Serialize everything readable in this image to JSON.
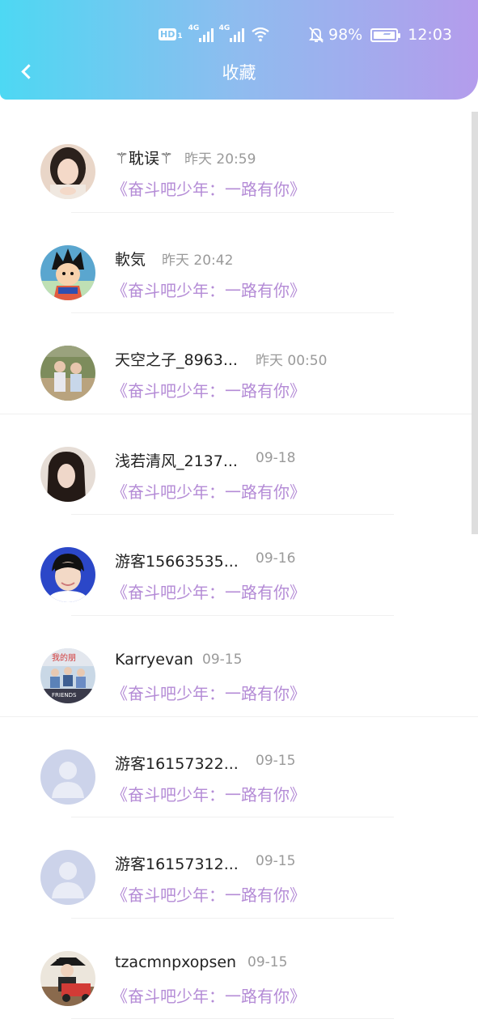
{
  "status_bar": {
    "hd_label": "HD",
    "hd_sub": "1",
    "sig1_label": "4G",
    "sig2_label": "4G",
    "battery_pct": "98%",
    "time": "12:03",
    "battery_level": 0.98
  },
  "header": {
    "title": "收藏",
    "gradient": [
      "#4dd8f3",
      "#b49cec"
    ]
  },
  "items": [
    {
      "name": "⚚耽误⚚",
      "time": "昨天 20:59",
      "subtitle": "《奋斗吧少年：一路有你》",
      "avatar": "photo-girl"
    },
    {
      "name": "軟気",
      "time": "昨天 20:42",
      "subtitle": "《奋斗吧少年：一路有你》",
      "avatar": "cartoon-boy"
    },
    {
      "name": "天空之子_8963...",
      "time": "昨天 00:50",
      "subtitle": "《奋斗吧少年：一路有你》",
      "avatar": "photo-kids"
    },
    {
      "name": "浅若清风_2137...",
      "time": "09-18",
      "subtitle": "《奋斗吧少年：一路有你》",
      "avatar": "photo-woman"
    },
    {
      "name": "游客15663535...",
      "time": "09-16",
      "subtitle": "《奋斗吧少年：一路有你》",
      "avatar": "photo-boy"
    },
    {
      "name": "Karryevan",
      "time": "09-15",
      "subtitle": "《奋斗吧少年：一路有你》",
      "avatar": "photo-group"
    },
    {
      "name": "游客16157322...",
      "time": "09-15",
      "subtitle": "《奋斗吧少年：一路有你》",
      "avatar": "default-avatar"
    },
    {
      "name": "游客16157312...",
      "time": "09-15",
      "subtitle": "《奋斗吧少年：一路有你》",
      "avatar": "default-avatar"
    },
    {
      "name": "tzacmnpxopsen",
      "time": "09-15",
      "subtitle": "《奋斗吧少年：一路有你》",
      "avatar": "photo-cowboy"
    }
  ],
  "colors": {
    "subtitle": "#b48bd6",
    "time": "#9a9a9a",
    "name": "#222222",
    "default_avatar_bg": "#ccd3ea"
  }
}
